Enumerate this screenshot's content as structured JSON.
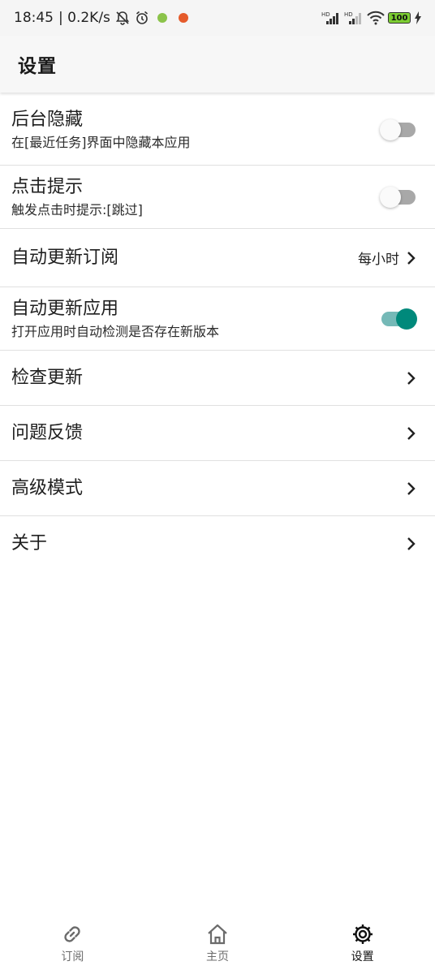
{
  "status_bar": {
    "time": "18:45",
    "net_speed": "| 0.2K/s",
    "battery": "100",
    "signal_hd1": "HD",
    "signal_hd2": "HD",
    "dot_green": "#8bc34a",
    "dot_orange": "#e55b2b"
  },
  "app_bar": {
    "title": "设置"
  },
  "settings": {
    "hide_background": {
      "label": "后台隐藏",
      "sub": "在[最近任务]界面中隐藏本应用",
      "enabled": false
    },
    "click_tip": {
      "label": "点击提示",
      "sub": "触发点击时提示:[跳过]",
      "enabled": false
    },
    "auto_update_subs": {
      "label": "自动更新订阅",
      "value": "每小时"
    },
    "auto_update_app": {
      "label": "自动更新应用",
      "sub": "打开应用时自动检测是否存在新版本",
      "enabled": true
    },
    "check_update": {
      "label": "检查更新"
    },
    "feedback": {
      "label": "问题反馈"
    },
    "advanced_mode": {
      "label": "高级模式"
    },
    "about": {
      "label": "关于"
    }
  },
  "bottom_nav": {
    "items": [
      {
        "label": "订阅",
        "icon": "link-icon",
        "active": false
      },
      {
        "label": "主页",
        "icon": "home-icon",
        "active": false
      },
      {
        "label": "设置",
        "icon": "gear-icon",
        "active": true
      }
    ]
  },
  "colors": {
    "accent": "#00897b",
    "accent_track": "#75b9b7",
    "switch_off_track": "#a8a8a8"
  }
}
